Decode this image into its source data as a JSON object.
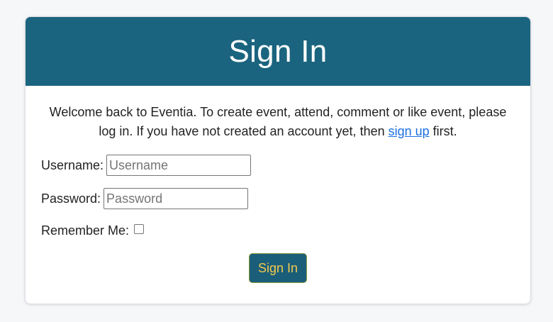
{
  "header": {
    "title": "Sign In"
  },
  "intro": {
    "before_link": "Welcome back to Eventia. To create event, attend, comment or like event, please log in. If you have not created an account yet, then ",
    "link_text": "sign up",
    "after_link": " first."
  },
  "form": {
    "username_label": "Username:",
    "username_placeholder": "Username",
    "username_value": "",
    "password_label": "Password:",
    "password_placeholder": "Password",
    "password_value": "",
    "remember_label": "Remember Me:",
    "remember_checked": false,
    "submit_label": "Sign In"
  },
  "colors": {
    "header_bg": "#1b647f",
    "button_bg": "#1b5e7a",
    "button_text": "#f2c94c",
    "link": "#1a6fe0"
  }
}
